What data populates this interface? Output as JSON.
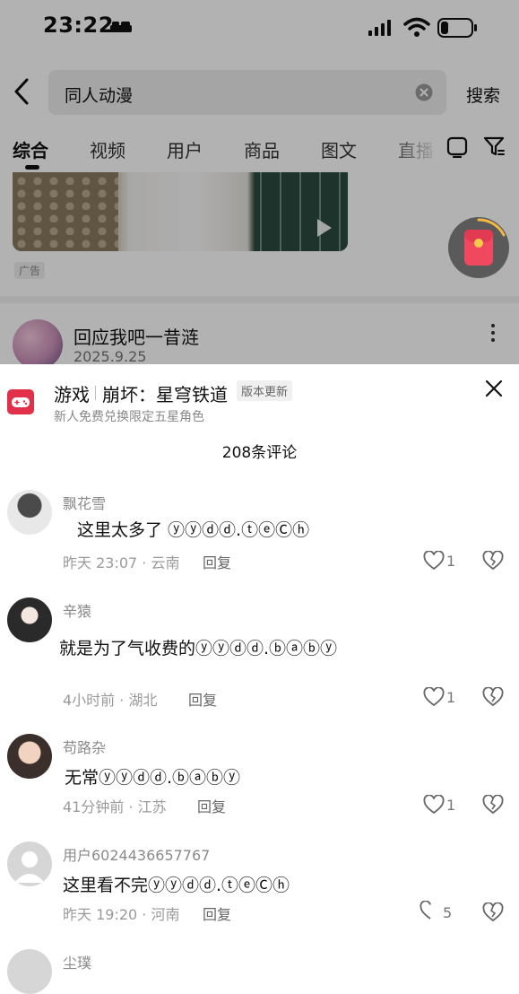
{
  "status_bar": {
    "time": "23:22"
  },
  "search": {
    "query": "同人动漫",
    "button_label": "搜索"
  },
  "tabs": [
    {
      "label": "综合",
      "active": true
    },
    {
      "label": "视频"
    },
    {
      "label": "用户"
    },
    {
      "label": "商品"
    },
    {
      "label": "图文"
    },
    {
      "label": "直播"
    }
  ],
  "feed": {
    "ad_label": "广告",
    "author": {
      "name": "回应我吧一昔涟",
      "date": "2025.9.25"
    }
  },
  "comments_panel": {
    "game_tag": "游戏",
    "game_title": "崩坏：星穹铁道",
    "update_badge": "版本更新",
    "game_subtitle": "新人免费兑换限定五星角色",
    "count_label": "208条评论",
    "reply_label": "回复",
    "comments": [
      {
        "user": "飘花雪",
        "text": "这里太多了 ⓨⓨⓓⓓ.ⓣⓔⒸⓗ",
        "time_location": "昨天 23:07 · 云南",
        "likes": "1"
      },
      {
        "user": "辛猿",
        "text": "就是为了气收费的ⓨⓨⓓⓓ.ⓑⓐⓑⓨ",
        "time_location": "4小时前 · 湖北",
        "likes": "1"
      },
      {
        "user": "苟路杂",
        "text": "无常ⓨⓨⓓⓓ.ⓑⓐⓑⓨ",
        "time_location": "41分钟前 · 江苏",
        "likes": "1"
      },
      {
        "user": "用户6024436657767",
        "text": "这里看不完ⓨⓨⓓⓓ.ⓣⓔⒸⓗ",
        "time_location": "昨天 19:20 · 河南",
        "likes": "5"
      },
      {
        "user": "尘璞"
      }
    ]
  },
  "colors": {
    "accent_red": "#f0495f",
    "meta_gray": "#9a9a9a",
    "game_icon": "#e0304a"
  }
}
